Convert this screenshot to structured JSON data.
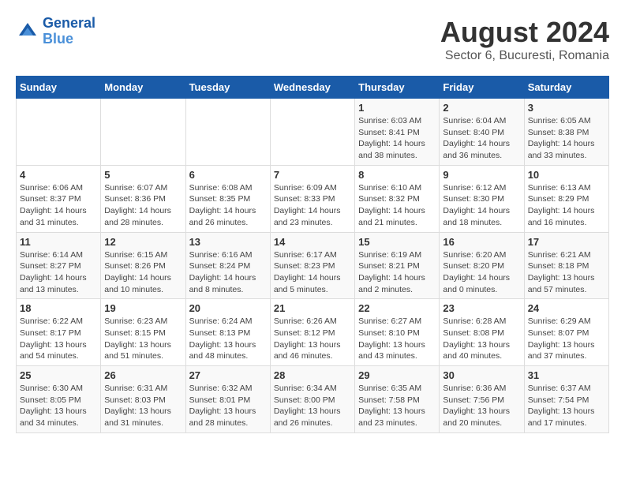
{
  "logo": {
    "line1": "General",
    "line2": "Blue"
  },
  "title": "August 2024",
  "subtitle": "Sector 6, Bucuresti, Romania",
  "days_of_week": [
    "Sunday",
    "Monday",
    "Tuesday",
    "Wednesday",
    "Thursday",
    "Friday",
    "Saturday"
  ],
  "weeks": [
    [
      {
        "day": "",
        "info": ""
      },
      {
        "day": "",
        "info": ""
      },
      {
        "day": "",
        "info": ""
      },
      {
        "day": "",
        "info": ""
      },
      {
        "day": "1",
        "info": "Sunrise: 6:03 AM\nSunset: 8:41 PM\nDaylight: 14 hours and 38 minutes."
      },
      {
        "day": "2",
        "info": "Sunrise: 6:04 AM\nSunset: 8:40 PM\nDaylight: 14 hours and 36 minutes."
      },
      {
        "day": "3",
        "info": "Sunrise: 6:05 AM\nSunset: 8:38 PM\nDaylight: 14 hours and 33 minutes."
      }
    ],
    [
      {
        "day": "4",
        "info": "Sunrise: 6:06 AM\nSunset: 8:37 PM\nDaylight: 14 hours and 31 minutes."
      },
      {
        "day": "5",
        "info": "Sunrise: 6:07 AM\nSunset: 8:36 PM\nDaylight: 14 hours and 28 minutes."
      },
      {
        "day": "6",
        "info": "Sunrise: 6:08 AM\nSunset: 8:35 PM\nDaylight: 14 hours and 26 minutes."
      },
      {
        "day": "7",
        "info": "Sunrise: 6:09 AM\nSunset: 8:33 PM\nDaylight: 14 hours and 23 minutes."
      },
      {
        "day": "8",
        "info": "Sunrise: 6:10 AM\nSunset: 8:32 PM\nDaylight: 14 hours and 21 minutes."
      },
      {
        "day": "9",
        "info": "Sunrise: 6:12 AM\nSunset: 8:30 PM\nDaylight: 14 hours and 18 minutes."
      },
      {
        "day": "10",
        "info": "Sunrise: 6:13 AM\nSunset: 8:29 PM\nDaylight: 14 hours and 16 minutes."
      }
    ],
    [
      {
        "day": "11",
        "info": "Sunrise: 6:14 AM\nSunset: 8:27 PM\nDaylight: 14 hours and 13 minutes."
      },
      {
        "day": "12",
        "info": "Sunrise: 6:15 AM\nSunset: 8:26 PM\nDaylight: 14 hours and 10 minutes."
      },
      {
        "day": "13",
        "info": "Sunrise: 6:16 AM\nSunset: 8:24 PM\nDaylight: 14 hours and 8 minutes."
      },
      {
        "day": "14",
        "info": "Sunrise: 6:17 AM\nSunset: 8:23 PM\nDaylight: 14 hours and 5 minutes."
      },
      {
        "day": "15",
        "info": "Sunrise: 6:19 AM\nSunset: 8:21 PM\nDaylight: 14 hours and 2 minutes."
      },
      {
        "day": "16",
        "info": "Sunrise: 6:20 AM\nSunset: 8:20 PM\nDaylight: 14 hours and 0 minutes."
      },
      {
        "day": "17",
        "info": "Sunrise: 6:21 AM\nSunset: 8:18 PM\nDaylight: 13 hours and 57 minutes."
      }
    ],
    [
      {
        "day": "18",
        "info": "Sunrise: 6:22 AM\nSunset: 8:17 PM\nDaylight: 13 hours and 54 minutes."
      },
      {
        "day": "19",
        "info": "Sunrise: 6:23 AM\nSunset: 8:15 PM\nDaylight: 13 hours and 51 minutes."
      },
      {
        "day": "20",
        "info": "Sunrise: 6:24 AM\nSunset: 8:13 PM\nDaylight: 13 hours and 48 minutes."
      },
      {
        "day": "21",
        "info": "Sunrise: 6:26 AM\nSunset: 8:12 PM\nDaylight: 13 hours and 46 minutes."
      },
      {
        "day": "22",
        "info": "Sunrise: 6:27 AM\nSunset: 8:10 PM\nDaylight: 13 hours and 43 minutes."
      },
      {
        "day": "23",
        "info": "Sunrise: 6:28 AM\nSunset: 8:08 PM\nDaylight: 13 hours and 40 minutes."
      },
      {
        "day": "24",
        "info": "Sunrise: 6:29 AM\nSunset: 8:07 PM\nDaylight: 13 hours and 37 minutes."
      }
    ],
    [
      {
        "day": "25",
        "info": "Sunrise: 6:30 AM\nSunset: 8:05 PM\nDaylight: 13 hours and 34 minutes."
      },
      {
        "day": "26",
        "info": "Sunrise: 6:31 AM\nSunset: 8:03 PM\nDaylight: 13 hours and 31 minutes."
      },
      {
        "day": "27",
        "info": "Sunrise: 6:32 AM\nSunset: 8:01 PM\nDaylight: 13 hours and 28 minutes."
      },
      {
        "day": "28",
        "info": "Sunrise: 6:34 AM\nSunset: 8:00 PM\nDaylight: 13 hours and 26 minutes."
      },
      {
        "day": "29",
        "info": "Sunrise: 6:35 AM\nSunset: 7:58 PM\nDaylight: 13 hours and 23 minutes."
      },
      {
        "day": "30",
        "info": "Sunrise: 6:36 AM\nSunset: 7:56 PM\nDaylight: 13 hours and 20 minutes."
      },
      {
        "day": "31",
        "info": "Sunrise: 6:37 AM\nSunset: 7:54 PM\nDaylight: 13 hours and 17 minutes."
      }
    ]
  ]
}
